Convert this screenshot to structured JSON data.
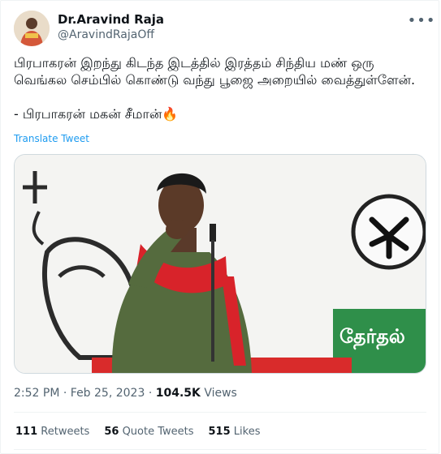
{
  "author": {
    "name": "Dr.Aravind Raja",
    "handle": "@AravindRajaOff"
  },
  "tweet": {
    "text": "பிரபாகரன் இறந்து கிடந்த இடத்தில் இரத்தம் சிந்திய மண் ஒரு வெங்கல செம்பில் கொண்டு வந்து பூஜை அறையில் வைத்துள்ளேன்.\n\n- பிரபாகரன் மகன் சீமான்🔥",
    "translate_label": "Translate Tweet"
  },
  "media": {
    "banner_text": "தேர்தல்"
  },
  "meta": {
    "time": "2:52 PM",
    "separator": "·",
    "date": "Feb 25, 2023",
    "views_count": "104.5K",
    "views_label": "Views"
  },
  "stats": {
    "retweets_count": "111",
    "retweets_label": "Retweets",
    "quotes_count": "56",
    "quotes_label": "Quote Tweets",
    "likes_count": "515",
    "likes_label": "Likes"
  },
  "icons": {
    "more": "more-horizontal-icon"
  },
  "colors": {
    "link": "#1d9bf0",
    "secondary": "#536471"
  }
}
